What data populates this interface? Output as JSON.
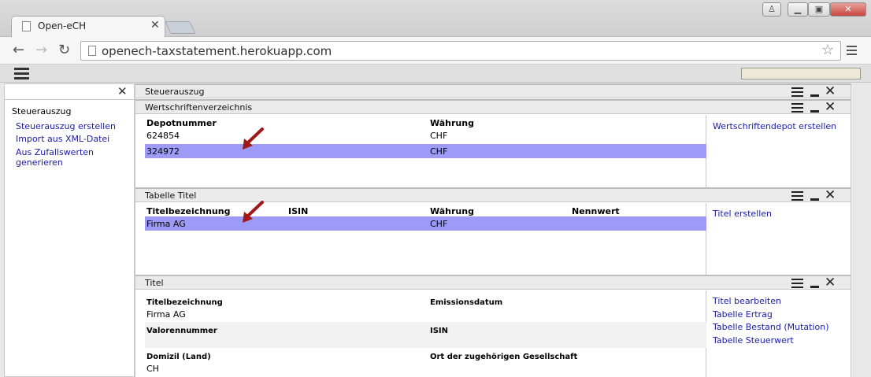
{
  "browser": {
    "tab_title": "Open-eCH",
    "url": "openech-taxstatement.herokuapp.com"
  },
  "sidebar": {
    "heading": "Steuerauszug",
    "links": [
      "Steuerauszug erstellen",
      "Import aus XML-Datei",
      "Aus Zufallswerten generieren"
    ]
  },
  "panels": {
    "steuerauszug": {
      "title": "Steuerauszug"
    },
    "wertschriften": {
      "title": "Wertschriftenverzeichnis",
      "headers": [
        "Depotnummer",
        "Währung"
      ],
      "rows": [
        {
          "depot": "624854",
          "currency": "CHF"
        },
        {
          "depot": "324972",
          "currency": "CHF",
          "selected": true
        }
      ],
      "action": "Wertschriftendepot erstellen"
    },
    "tabelle_titel": {
      "title": "Tabelle Titel",
      "headers": [
        "Titelbezeichnung",
        "ISIN",
        "Währung",
        "Nennwert"
      ],
      "rows": [
        {
          "name": "Firma AG",
          "isin": "",
          "currency": "CHF",
          "nominal": "",
          "selected": true
        }
      ],
      "action": "Titel erstellen"
    },
    "titel": {
      "title": "Titel",
      "fields": {
        "titelbezeichnung_label": "Titelbezeichnung",
        "titelbezeichnung_value": "Firma AG",
        "emissionsdatum_label": "Emissionsdatum",
        "valorennummer_label": "Valorennummer",
        "isin_label": "ISIN",
        "domizil_label": "Domizil (Land)",
        "domizil_value": "CH",
        "ort_label": "Ort der zugehörigen Gesellschaft"
      },
      "actions": [
        "Titel bearbeiten",
        "Tabelle Ertrag",
        "Tabelle Bestand (Mutation)",
        "Tabelle Steuerwert"
      ]
    }
  },
  "colors": {
    "selection": "#9d9af8",
    "link": "#1a1aa6",
    "annotation_arrow": "#a01818"
  }
}
